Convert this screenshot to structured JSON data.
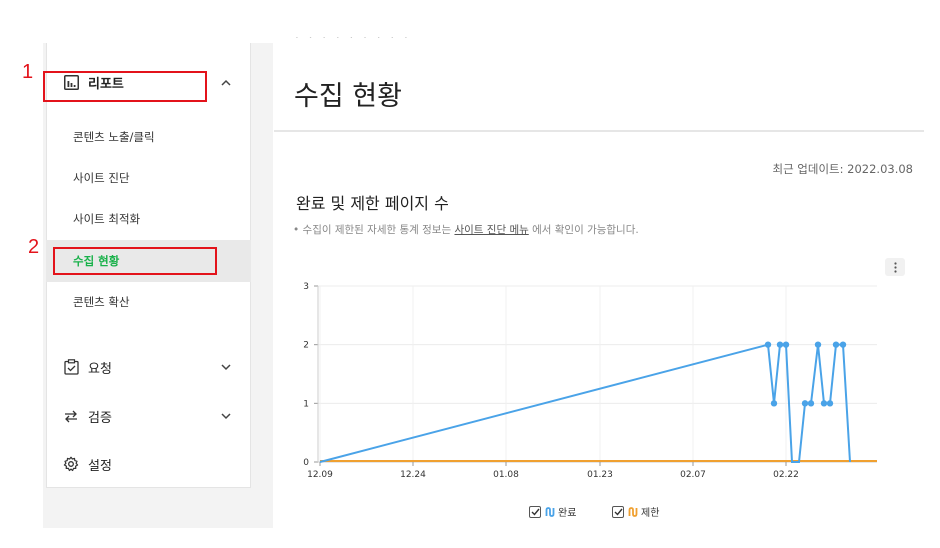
{
  "sidebar": {
    "report_label": "리포트",
    "report_items": [
      {
        "label": "콘텐츠 노출/클릭"
      },
      {
        "label": "사이트 진단"
      },
      {
        "label": "사이트 최적화"
      },
      {
        "label": "수집 현황",
        "active": true
      },
      {
        "label": "콘텐츠 확산"
      }
    ],
    "request_label": "요청",
    "verify_label": "검증",
    "settings_label": "설정"
  },
  "annotations": [
    "1",
    "2"
  ],
  "main": {
    "cut_text": "· · · · · · · · ·",
    "title": "수집 현황",
    "last_update": "최근 업데이트: 2022.03.08",
    "section_title": "완료 및 제한 페이지 수",
    "notice_prefix": "• 수집이 제한된 자세한 통계 정보는 ",
    "notice_link": "사이트 진단 메뉴",
    "notice_suffix": " 에서 확인이 가능합니다."
  },
  "colors": {
    "accent": "#19b14a",
    "annotation": "#e3131b",
    "series_done": "#4aa3e8",
    "series_limited": "#f0a030"
  },
  "chart_data": {
    "type": "line",
    "x_tick_labels": [
      "12.09",
      "12.24",
      "01.08",
      "01.23",
      "02.07",
      "02.22"
    ],
    "ylim": [
      0,
      3
    ],
    "y_ticks": [
      0,
      1,
      2,
      3
    ],
    "grid": true,
    "legend_position": "bottom",
    "series": [
      {
        "name": "완료",
        "color": "#4aa3e8",
        "values": [
          0,
          2,
          1,
          2,
          2,
          0,
          0,
          1,
          1,
          2,
          1,
          1,
          2,
          2,
          0
        ]
      },
      {
        "name": "제한",
        "color": "#f0a030",
        "values": [
          0,
          0,
          0,
          0,
          0,
          0,
          0,
          0,
          0,
          0,
          0,
          0,
          0,
          0,
          0
        ]
      }
    ]
  }
}
